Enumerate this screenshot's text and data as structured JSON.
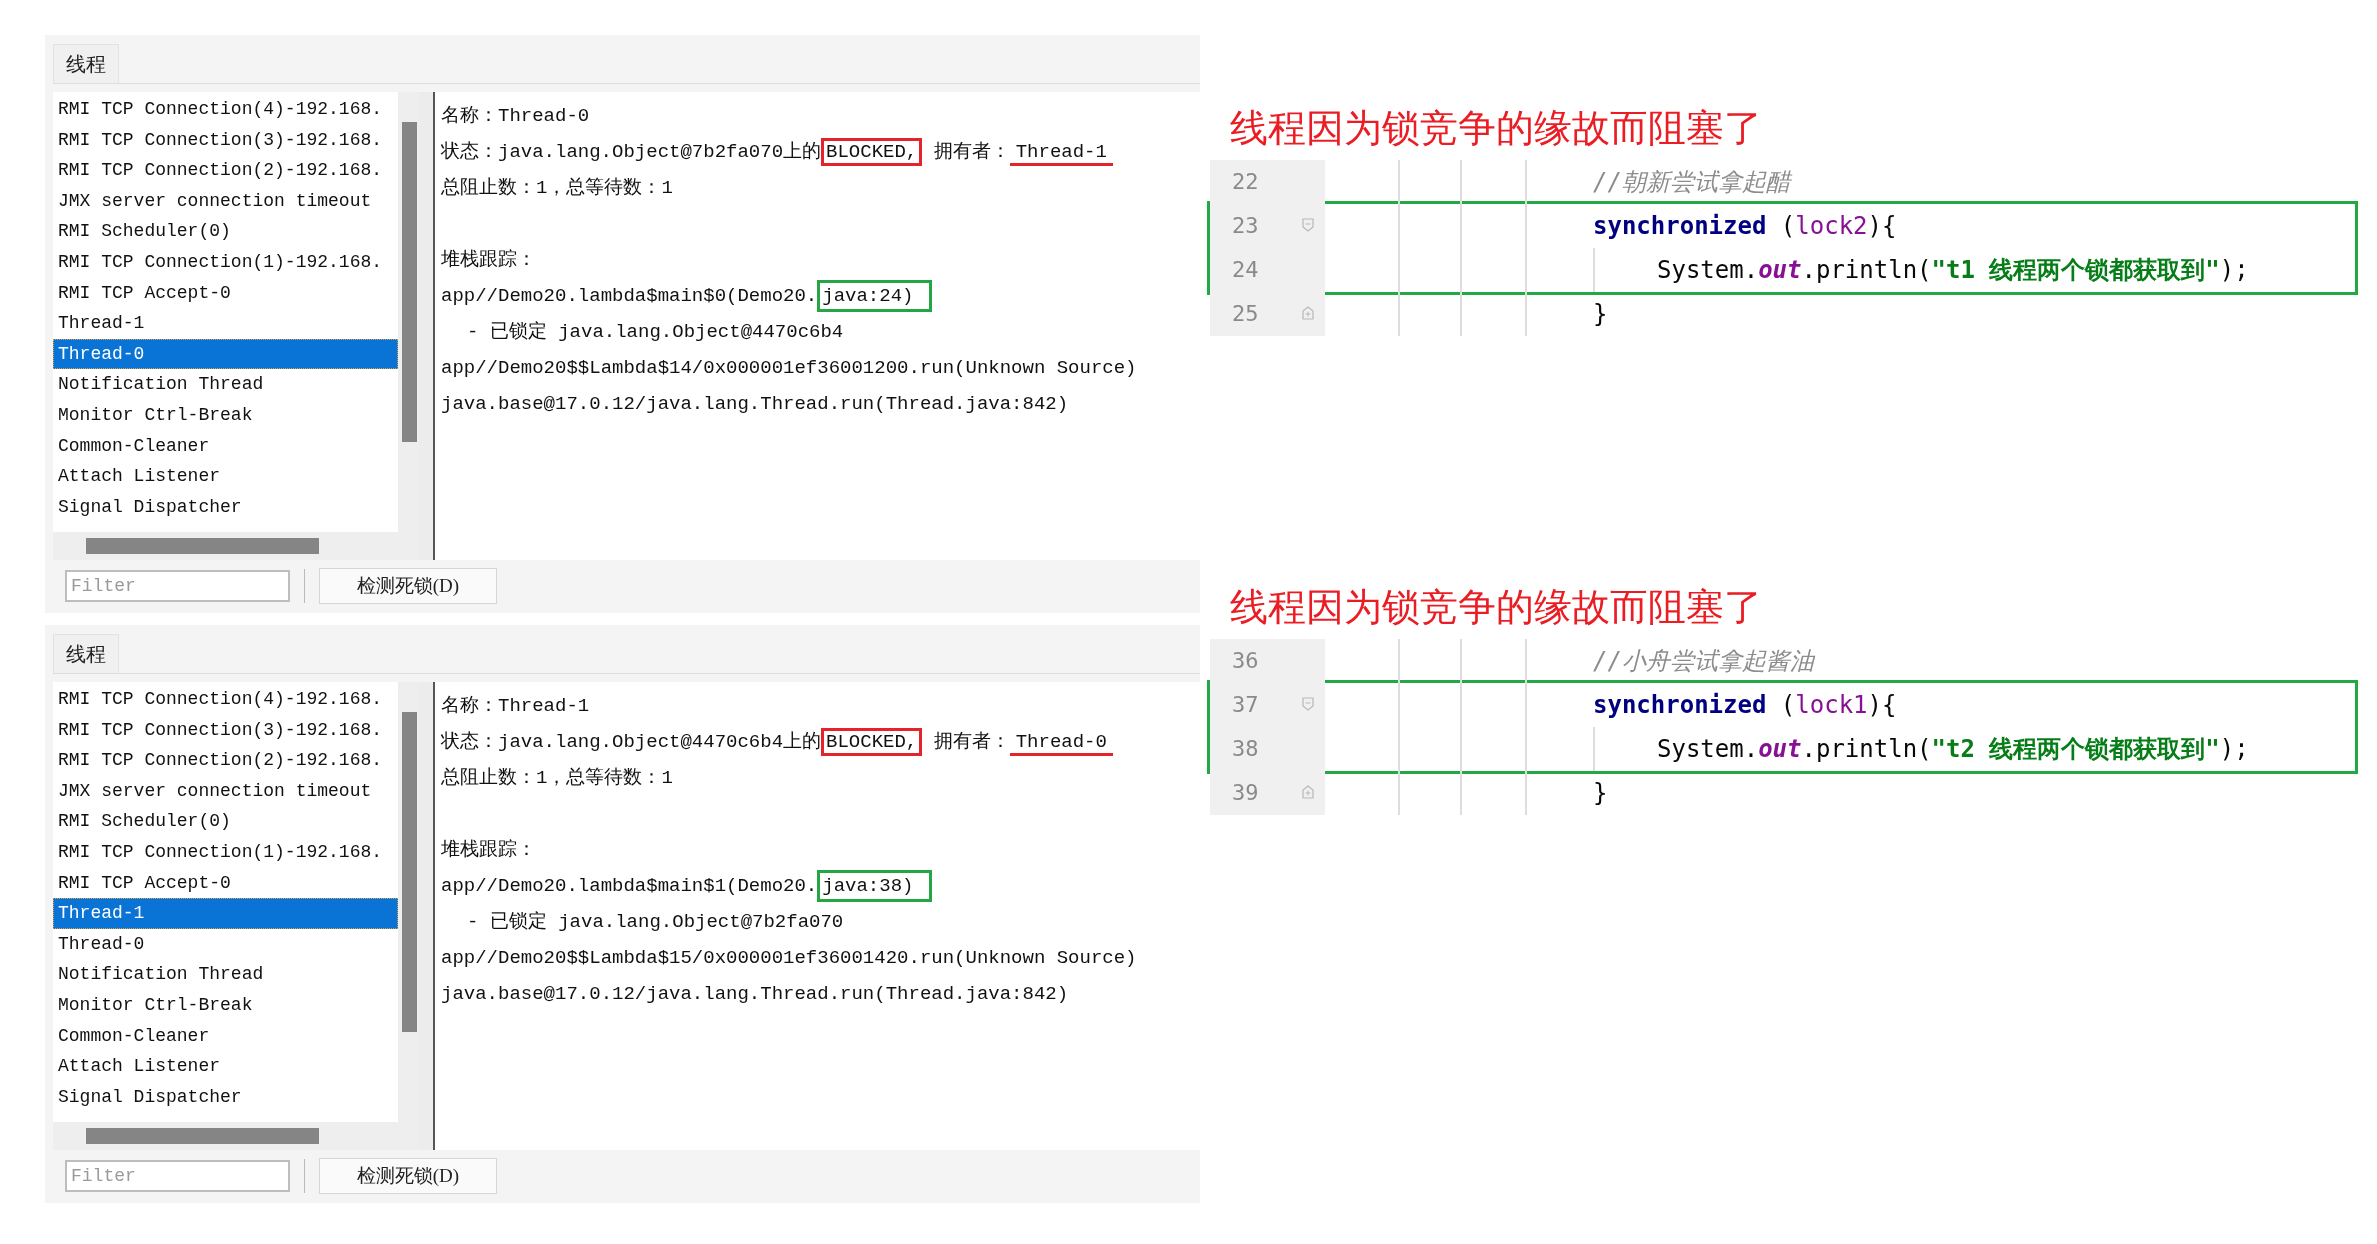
{
  "thread_panels": [
    {
      "tab": "线程",
      "threads": [
        {
          "name": "RMI TCP Connection(4)-192.168.",
          "selected": false
        },
        {
          "name": "RMI TCP Connection(3)-192.168.",
          "selected": false
        },
        {
          "name": "RMI TCP Connection(2)-192.168.",
          "selected": false
        },
        {
          "name": "JMX server connection timeout",
          "selected": false
        },
        {
          "name": "RMI Scheduler(0)",
          "selected": false
        },
        {
          "name": "RMI TCP Connection(1)-192.168.",
          "selected": false
        },
        {
          "name": "RMI TCP Accept-0",
          "selected": false
        },
        {
          "name": "Thread-1",
          "selected": false
        },
        {
          "name": "Thread-0",
          "selected": true
        },
        {
          "name": "Notification Thread",
          "selected": false
        },
        {
          "name": "Monitor Ctrl-Break",
          "selected": false
        },
        {
          "name": "Common-Cleaner",
          "selected": false
        },
        {
          "name": "Attach Listener",
          "selected": false
        },
        {
          "name": "Signal Dispatcher",
          "selected": false
        }
      ],
      "details": {
        "name_line": "名称：Thread-0",
        "state_prefix": "状态：java.lang.Object@7b2fa070上的",
        "state": "BLOCKED,",
        "owner_label": "拥有者：",
        "owner": "Thread-1",
        "counts": "总阻止数：1，总等待数：1",
        "stack_label": "堆栈跟踪：",
        "stack": [
          {
            "kind": "frame",
            "text": "app//Demo20.lambda$main$0(Demo20.",
            "highlight": "java:24)"
          },
          {
            "kind": "lock",
            "text": "- 已锁定 java.lang.Object@4470c6b4"
          },
          {
            "kind": "frame",
            "text": "app//Demo20$$Lambda$14/0x000001ef36001200.run(Unknown Source)"
          },
          {
            "kind": "frame",
            "text": "java.base@17.0.12/java.lang.Thread.run(Thread.java:842)"
          }
        ]
      },
      "filter_placeholder": "Filter",
      "button": "检测死锁(D)"
    },
    {
      "tab": "线程",
      "threads": [
        {
          "name": "RMI TCP Connection(4)-192.168.",
          "selected": false
        },
        {
          "name": "RMI TCP Connection(3)-192.168.",
          "selected": false
        },
        {
          "name": "RMI TCP Connection(2)-192.168.",
          "selected": false
        },
        {
          "name": "JMX server connection timeout",
          "selected": false
        },
        {
          "name": "RMI Scheduler(0)",
          "selected": false
        },
        {
          "name": "RMI TCP Connection(1)-192.168.",
          "selected": false
        },
        {
          "name": "RMI TCP Accept-0",
          "selected": false
        },
        {
          "name": "Thread-1",
          "selected": true
        },
        {
          "name": "Thread-0",
          "selected": false
        },
        {
          "name": "Notification Thread",
          "selected": false
        },
        {
          "name": "Monitor Ctrl-Break",
          "selected": false
        },
        {
          "name": "Common-Cleaner",
          "selected": false
        },
        {
          "name": "Attach Listener",
          "selected": false
        },
        {
          "name": "Signal Dispatcher",
          "selected": false
        }
      ],
      "details": {
        "name_line": "名称：Thread-1",
        "state_prefix": "状态：java.lang.Object@4470c6b4上的",
        "state": "BLOCKED,",
        "owner_label": "拥有者：",
        "owner": "Thread-0",
        "counts": "总阻止数：1，总等待数：1",
        "stack_label": "堆栈跟踪：",
        "stack": [
          {
            "kind": "frame",
            "text": "app//Demo20.lambda$main$1(Demo20.",
            "highlight": "java:38)"
          },
          {
            "kind": "lock",
            "text": "- 已锁定 java.lang.Object@7b2fa070"
          },
          {
            "kind": "frame",
            "text": "app//Demo20$$Lambda$15/0x000001ef36001420.run(Unknown Source)"
          },
          {
            "kind": "frame",
            "text": "java.base@17.0.12/java.lang.Thread.run(Thread.java:842)"
          }
        ]
      },
      "filter_placeholder": "Filter",
      "button": "检测死锁(D)"
    }
  ],
  "annotations": [
    {
      "caption": "线程因为锁竞争的缘故而阻塞了",
      "code_lines": [
        {
          "number": "22",
          "kind": "line",
          "highlighted": false,
          "tokens": [
            {
              "kind": "comment",
              "text": "//朝新尝试拿起醋"
            }
          ]
        },
        {
          "number": "23",
          "kind": "block_start",
          "highlighted": true,
          "tokens": [
            {
              "kind": "keyword",
              "text": "synchronized"
            },
            {
              "kind": "plain",
              "text": " ("
            },
            {
              "kind": "variable",
              "text": "lock2"
            },
            {
              "kind": "plain",
              "text": "){"
            }
          ],
          "children": [
            {
              "number": "24",
              "kind": "line",
              "highlighted": true,
              "tokens": [
                {
                  "kind": "plain",
                  "text": "System."
                },
                {
                  "kind": "field",
                  "text": "out"
                },
                {
                  "kind": "plain",
                  "text": ".println("
                },
                {
                  "kind": "string",
                  "text": "\"t1 线程两个锁都获取到\""
                },
                {
                  "kind": "plain",
                  "text": ");"
                }
              ]
            }
          ]
        },
        {
          "number": "25",
          "kind": "block_end",
          "highlighted": false,
          "tokens": [
            {
              "kind": "plain",
              "text": "}"
            }
          ]
        }
      ]
    },
    {
      "caption": "线程因为锁竞争的缘故而阻塞了",
      "code_lines": [
        {
          "number": "36",
          "kind": "line",
          "highlighted": false,
          "tokens": [
            {
              "kind": "comment",
              "text": "//小舟尝试拿起酱油"
            }
          ]
        },
        {
          "number": "37",
          "kind": "block_start",
          "highlighted": true,
          "tokens": [
            {
              "kind": "keyword",
              "text": "synchronized"
            },
            {
              "kind": "plain",
              "text": " ("
            },
            {
              "kind": "variable",
              "text": "lock1"
            },
            {
              "kind": "plain",
              "text": "){"
            }
          ],
          "children": [
            {
              "number": "38",
              "kind": "line",
              "highlighted": true,
              "tokens": [
                {
                  "kind": "plain",
                  "text": "System."
                },
                {
                  "kind": "field",
                  "text": "out"
                },
                {
                  "kind": "plain",
                  "text": ".println("
                },
                {
                  "kind": "string",
                  "text": "\"t2 线程两个锁都获取到\""
                },
                {
                  "kind": "plain",
                  "text": ");"
                }
              ]
            }
          ]
        },
        {
          "number": "39",
          "kind": "block_end",
          "highlighted": false,
          "tokens": [
            {
              "kind": "plain",
              "text": "}"
            }
          ]
        }
      ]
    }
  ]
}
